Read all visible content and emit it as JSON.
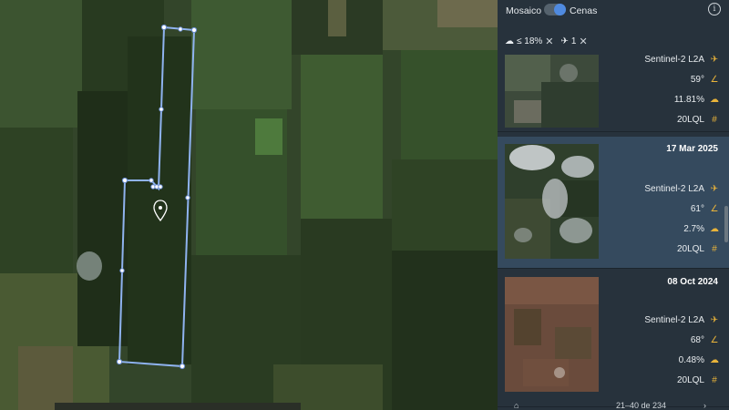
{
  "panel": {
    "mode_mosaic": "Mosaico",
    "mode_scenes": "Cenas",
    "filters": [
      {
        "label": "≤ 18%",
        "icon": "cloud-icon"
      },
      {
        "label": "1",
        "icon": "satellite-icon"
      }
    ],
    "scenes": [
      {
        "date": "",
        "satellite": "Sentinel-2  L2A",
        "angle": "59°",
        "cloud": "11.81%",
        "tile": "20LQL",
        "selected": false
      },
      {
        "date": "17 Mar 2025",
        "satellite": "Sentinel-2  L2A",
        "angle": "61°",
        "cloud": "2.7%",
        "tile": "20LQL",
        "selected": true
      },
      {
        "date": "08 Oct 2024",
        "satellite": "Sentinel-2  L2A",
        "angle": "68°",
        "cloud": "0.48%",
        "tile": "20LQL",
        "selected": false
      }
    ],
    "pagination": "21–40 de 234"
  },
  "colors": {
    "polygon": "#8fb3f0",
    "selected_card": "#354a5e",
    "panel_bg": "#27323c",
    "accent_icon": "#e8b33a",
    "toggle": "#4f8ae0"
  }
}
